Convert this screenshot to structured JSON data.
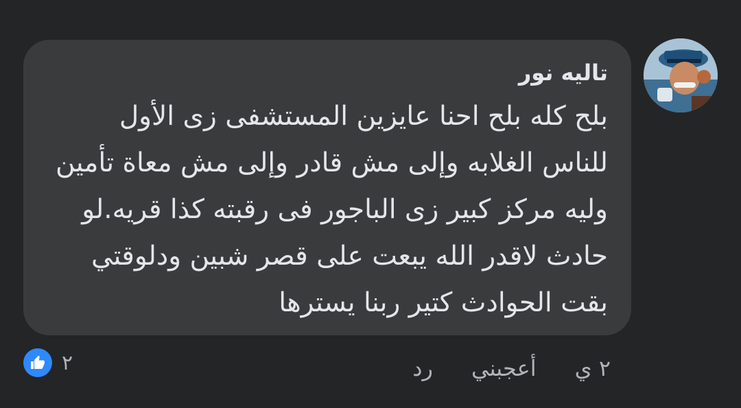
{
  "comment": {
    "author": "تاليه نور",
    "text": "بلح كله بلح احنا عايزين المستشفى زى الأول للناس الغلابه وإلى مش قادر وإلى مش معاة تأمين وليه مركز كبير زى الباجور فى رقبته كذا قريه.لو حادث لاقدر الله يبعت على قصر شبين ودلوقتي بقت الحوادث كتير ربنا يسترها",
    "time": "٢ ي",
    "like_label": "أعجبني",
    "reply_label": "رد",
    "reaction_count": "٢",
    "reaction_icon": "like-icon",
    "reaction_color": "#2e89ff"
  }
}
